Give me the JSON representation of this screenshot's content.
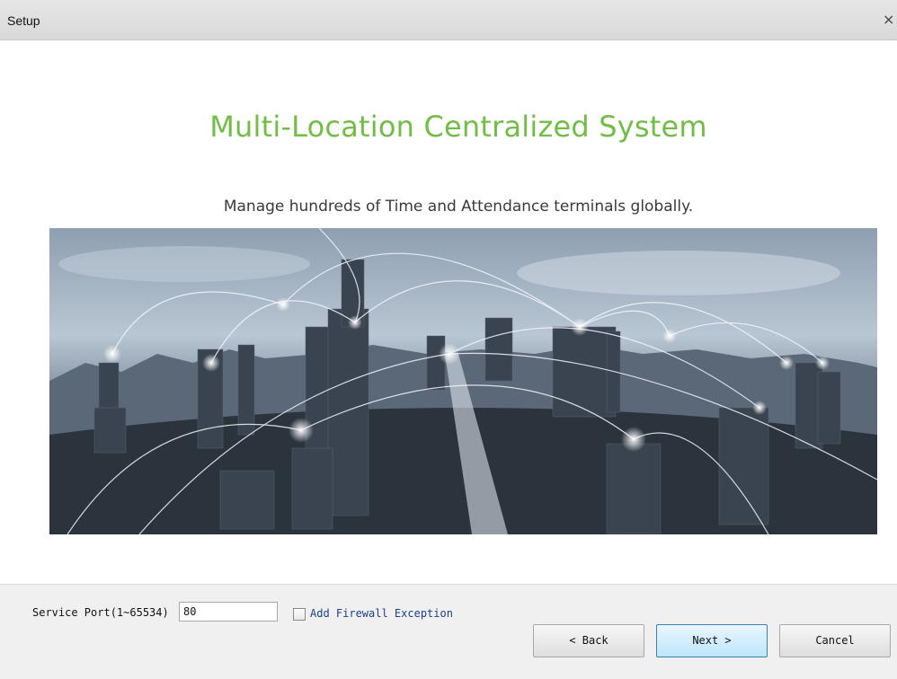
{
  "window": {
    "title": "Setup",
    "close_symbol": "×"
  },
  "main": {
    "headline": "Multi-Location Centralized System",
    "subline": "Manage hundreds of Time and Attendance terminals globally."
  },
  "footer": {
    "port_label": "Service Port(1~65534)",
    "port_value": "80",
    "firewall_label": "Add Firewall Exception",
    "firewall_checked": false,
    "back_label": "< Back",
    "next_label": "Next >",
    "cancel_label": "Cancel"
  },
  "colors": {
    "headline": "#72bd45",
    "next_button": "#bee6fd"
  }
}
